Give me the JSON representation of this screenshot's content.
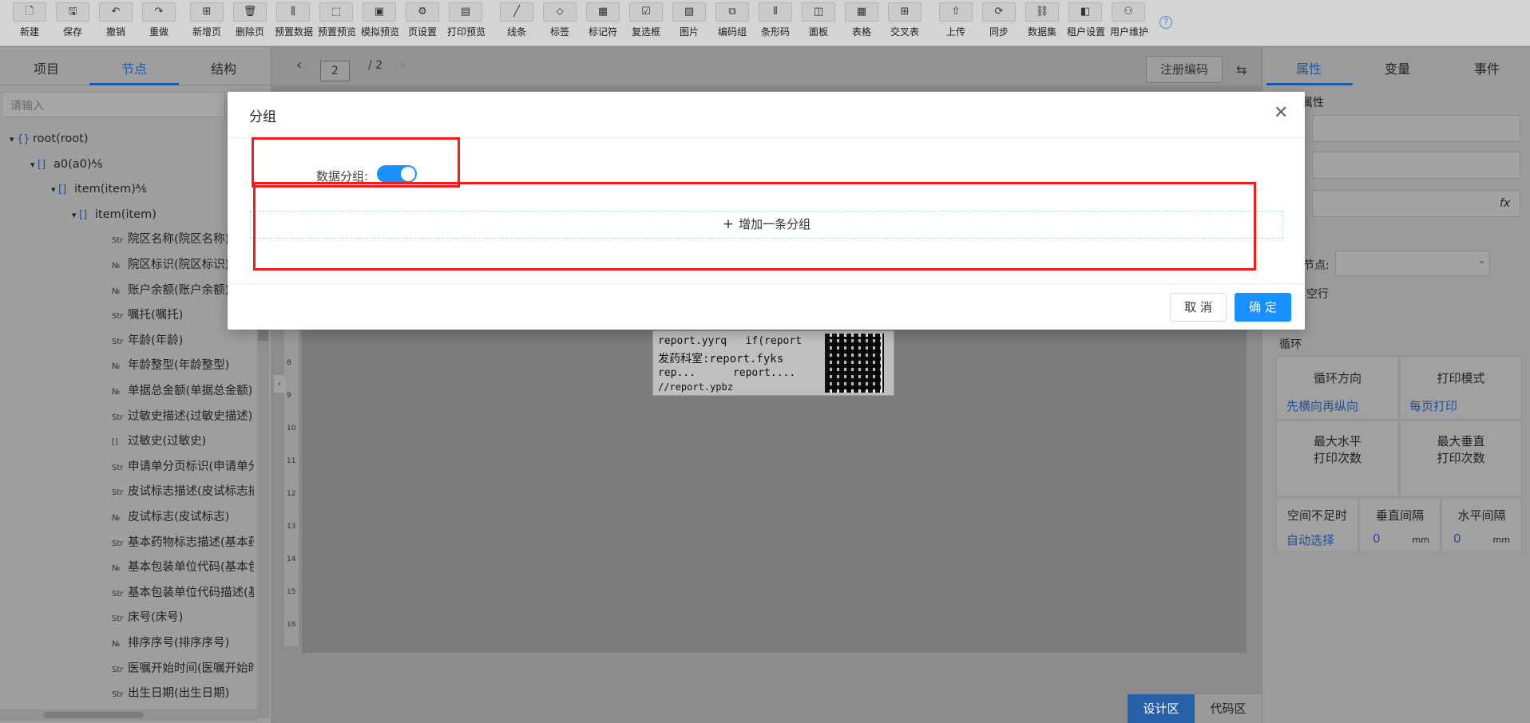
{
  "toolbar": {
    "items": [
      {
        "label": "新建",
        "icon": "new-file-icon",
        "glyph": "🗋"
      },
      {
        "label": "保存",
        "icon": "save-icon",
        "glyph": "🖫"
      },
      {
        "label": "撤销",
        "icon": "undo-icon",
        "glyph": "↶"
      },
      {
        "label": "重做",
        "icon": "redo-icon",
        "glyph": "↷"
      },
      {
        "label": "新增页",
        "icon": "add-page-icon",
        "glyph": "⊞"
      },
      {
        "label": "删除页",
        "icon": "delete-page-icon",
        "glyph": "🗑"
      },
      {
        "label": "预置数据",
        "icon": "preset-data-icon",
        "glyph": "⫼"
      },
      {
        "label": "预置预览",
        "icon": "preset-preview-icon",
        "glyph": "⬚"
      },
      {
        "label": "模拟预览",
        "icon": "simulate-preview-icon",
        "glyph": "▣"
      },
      {
        "label": "页设置",
        "icon": "page-settings-icon",
        "glyph": "⚙"
      },
      {
        "label": "打印预览",
        "icon": "print-preview-icon",
        "glyph": "▤"
      },
      {
        "label": "线条",
        "icon": "line-icon",
        "glyph": "╱"
      },
      {
        "label": "标签",
        "icon": "tag-icon",
        "glyph": "⬦"
      },
      {
        "label": "标记符",
        "icon": "marker-icon",
        "glyph": "▦"
      },
      {
        "label": "复选框",
        "icon": "checkbox-icon",
        "glyph": "☑"
      },
      {
        "label": "图片",
        "icon": "image-icon",
        "glyph": "▨"
      },
      {
        "label": "编码组",
        "icon": "code-group-icon",
        "glyph": "⧉"
      },
      {
        "label": "条形码",
        "icon": "barcode-icon",
        "glyph": "⦀"
      },
      {
        "label": "面板",
        "icon": "panel-icon",
        "glyph": "◫"
      },
      {
        "label": "表格",
        "icon": "table-icon",
        "glyph": "▦"
      },
      {
        "label": "交叉表",
        "icon": "crosstab-icon",
        "glyph": "⊞"
      },
      {
        "label": "上传",
        "icon": "upload-icon",
        "glyph": "⇧"
      },
      {
        "label": "同步",
        "icon": "sync-icon",
        "glyph": "⟳"
      },
      {
        "label": "数据集",
        "icon": "dataset-icon",
        "glyph": "⛓"
      },
      {
        "label": "租户设置",
        "icon": "tenant-settings-icon",
        "glyph": "◧"
      },
      {
        "label": "用户维护",
        "icon": "user-maintain-icon",
        "glyph": "⚇"
      }
    ]
  },
  "left": {
    "tabs": [
      "项目",
      "节点",
      "结构"
    ],
    "search_placeholder": "请输入",
    "tree": [
      {
        "tag": "{}",
        "label": "root(root)",
        "lvl": 0
      },
      {
        "tag": "[]",
        "label": "a0(a0)⅍",
        "lvl": 1
      },
      {
        "tag": "[]",
        "label": "item(item)⅍",
        "lvl": 2
      },
      {
        "tag": "[]",
        "label": "item(item)",
        "lvl": 3
      },
      {
        "tag": "Str",
        "label": "院区名称(院区名称)",
        "lvl": 4
      },
      {
        "tag": "№",
        "label": "院区标识(院区标识)",
        "lvl": 4
      },
      {
        "tag": "№",
        "label": "账户余额(账户余额)",
        "lvl": 4
      },
      {
        "tag": "Str",
        "label": "嘱托(嘱托)",
        "lvl": 4
      },
      {
        "tag": "Str",
        "label": "年龄(年龄)",
        "lvl": 4
      },
      {
        "tag": "№",
        "label": "年龄整型(年龄整型)",
        "lvl": 4
      },
      {
        "tag": "№",
        "label": "单据总金额(单据总金额)",
        "lvl": 4
      },
      {
        "tag": "Str",
        "label": "过敏史描述(过敏史描述)",
        "lvl": 4
      },
      {
        "tag": "[]",
        "label": "过敏史(过敏史)",
        "lvl": 4
      },
      {
        "tag": "Str",
        "label": "申请单分页标识(申请单分页标识)",
        "lvl": 4
      },
      {
        "tag": "Str",
        "label": "皮试标志描述(皮试标志描述)",
        "lvl": 4
      },
      {
        "tag": "№",
        "label": "皮试标志(皮试标志)",
        "lvl": 4
      },
      {
        "tag": "Str",
        "label": "基本药物标志描述(基本药物标志描述)",
        "lvl": 4
      },
      {
        "tag": "№",
        "label": "基本包装单位代码(基本包装单位代码)",
        "lvl": 4
      },
      {
        "tag": "Str",
        "label": "基本包装单位代码描述(基本包装单位代码描述)",
        "lvl": 4
      },
      {
        "tag": "Str",
        "label": "床号(床号)",
        "lvl": 4
      },
      {
        "tag": "№",
        "label": "排序序号(排序序号)",
        "lvl": 4
      },
      {
        "tag": "Str",
        "label": "医嘱开始时间(医嘱开始时间)",
        "lvl": 4
      },
      {
        "tag": "Str",
        "label": "出生日期(出生日期)",
        "lvl": 4
      }
    ]
  },
  "center": {
    "page_current": "2",
    "page_total": "/ 2",
    "register_btn": "注册编码",
    "card_lines": [
      "report.yyrq   if(report",
      "发药科室:report.fyks",
      "rep...      report....",
      "//report.ypbz"
    ],
    "ruler_nums": [
      "8",
      "9",
      "10",
      "11",
      "12",
      "13",
      "14",
      "15",
      "16"
    ],
    "bottom_tabs": [
      "设计区",
      "代码区"
    ]
  },
  "right": {
    "tabs": [
      "属性",
      "变量",
      "事件"
    ],
    "sec_attr": "属性",
    "fx": "fx",
    "node_label": "节点:",
    "empty_row_label": "空行",
    "loop_title": "循环",
    "loop_dir_label": "循环方向",
    "loop_dir_value": "先横向再纵向",
    "print_mode_label": "打印模式",
    "print_mode_value": "每页打印",
    "max_h_label": "最大水平\n打印次数",
    "max_v_label": "最大垂直\n打印次数",
    "space_label": "空间不足时",
    "space_value": "自动选择",
    "vgap_label": "垂直间隔",
    "vgap_value": "0",
    "hgap_label": "水平间隔",
    "hgap_value": "0",
    "unit": "mm"
  },
  "modal": {
    "title": "分组",
    "toggle_label": "数据分组:",
    "toggle_on": true,
    "add_label": "增加一条分组",
    "cancel": "取 消",
    "ok": "确 定"
  },
  "colors": {
    "primary": "#1890ff",
    "highlight": "#ef1d1d"
  }
}
